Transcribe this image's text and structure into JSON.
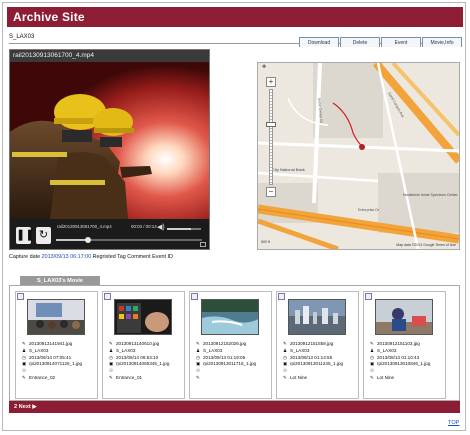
{
  "app": {
    "title": "Archive Site"
  },
  "user": "S_LAX03",
  "tabs": [
    "Download",
    "Delete",
    "Event",
    "Movie,Info"
  ],
  "player": {
    "filename": "rail20130913061700_4.mp4",
    "clip_name": "rail20130913061700_4.mp4",
    "time": "00:03 / 00:14",
    "progress_fraction": 0.22,
    "volume_fraction": 0.7
  },
  "map": {
    "terms": "Map data ©2013 Google  Terms of Use",
    "scale": "500 ft",
    "labels": [
      "City National Bank",
      "Nordstrom Irvine Spectrum Center",
      "Enterprise Dr",
      "Irvine Center Dr",
      "Sand Canyon Ave"
    ],
    "road_color": "#f2a33a",
    "route_color": "#d02020"
  },
  "capture": {
    "label": "Capture date",
    "date": "2013/09/13 06:17:00",
    "extra": "Regristed Tag Comment Event ID"
  },
  "movies_tab": "S_LAX03's Movie",
  "cards": [
    {
      "file": "20130913141941.jpg",
      "user": "S_LAX03",
      "date": "2013/09/14 07:05:41",
      "source": "rpi20130914071126_1.jpg",
      "event_icon": "☉",
      "event": "Entrance_02"
    },
    {
      "file": "20130913140610.jpg",
      "user": "S_LAX03",
      "date": "2013/09/14 06:53:10",
      "source": "rpi20130914065345_1.jpg",
      "event_icon": "☉",
      "event": "Entrance_01"
    },
    {
      "file": "20130912152026.jpg",
      "user": "S_LAX03",
      "date": "2013/09/13 01:19:05",
      "source": "rpi20130913011716_1.jpg",
      "event_icon": "☉",
      "event": ""
    },
    {
      "file": "20130912151558.jpg",
      "user": "S_LAX03",
      "date": "2013/09/13 01:14:55",
      "source": "rpi20130913011245_1.jpg",
      "event_icon": "☉",
      "event": "Lot Nine"
    },
    {
      "file": "20130912151103.jpg",
      "user": "S_LAX03",
      "date": "2013/09/13 01:10:43",
      "source": "rpi20130913010846_1.jpg",
      "event_icon": "☉",
      "event": "Lot Nine"
    }
  ],
  "footer": "2 Next ▶",
  "top_link": "TOP",
  "colors": {
    "accent": "#8c1d35",
    "link": "#1a4db3"
  }
}
